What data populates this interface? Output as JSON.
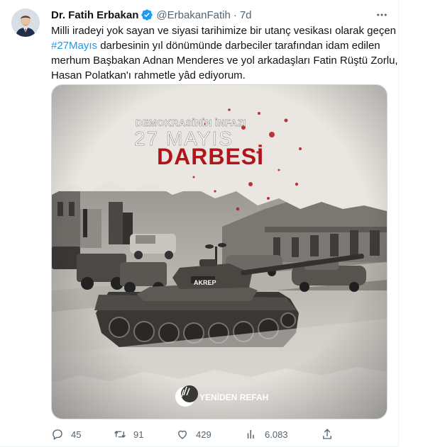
{
  "tweet": {
    "display_name": "Dr. Fatih Erbakan",
    "handle": "@ErbakanFatih",
    "separator": "·",
    "time": "7d",
    "text_lines": [
      "Milli iradeyi yok sayan ve siyasi tarihimize bir utanç vesikası olarak geçen",
      "darbesinin yıl dönümünde darbeciler tarafından idam edilen",
      "merhum Başbakan Adnan Menderes ve yol arkadaşları Fatin Rüştü Zorlu,",
      "Hasan Polatkan'ı rahmetle yâd ediyorum."
    ],
    "hashtag": "#27Mayıs"
  },
  "media": {
    "line1": "DEMOKRASİNİN İNFAZI",
    "line2": "27 MAYIS",
    "line3": "DARBESİ",
    "tank_label": "AKREP",
    "brand": "YENİDEN REFAH",
    "accent_red": "#b0151b"
  },
  "actions": {
    "replies": "45",
    "retweets": "91",
    "likes": "429",
    "views": "6.083"
  },
  "icons": [
    "verified-badge-icon",
    "more-icon",
    "reply-icon",
    "retweet-icon",
    "like-icon",
    "views-icon",
    "share-icon"
  ]
}
